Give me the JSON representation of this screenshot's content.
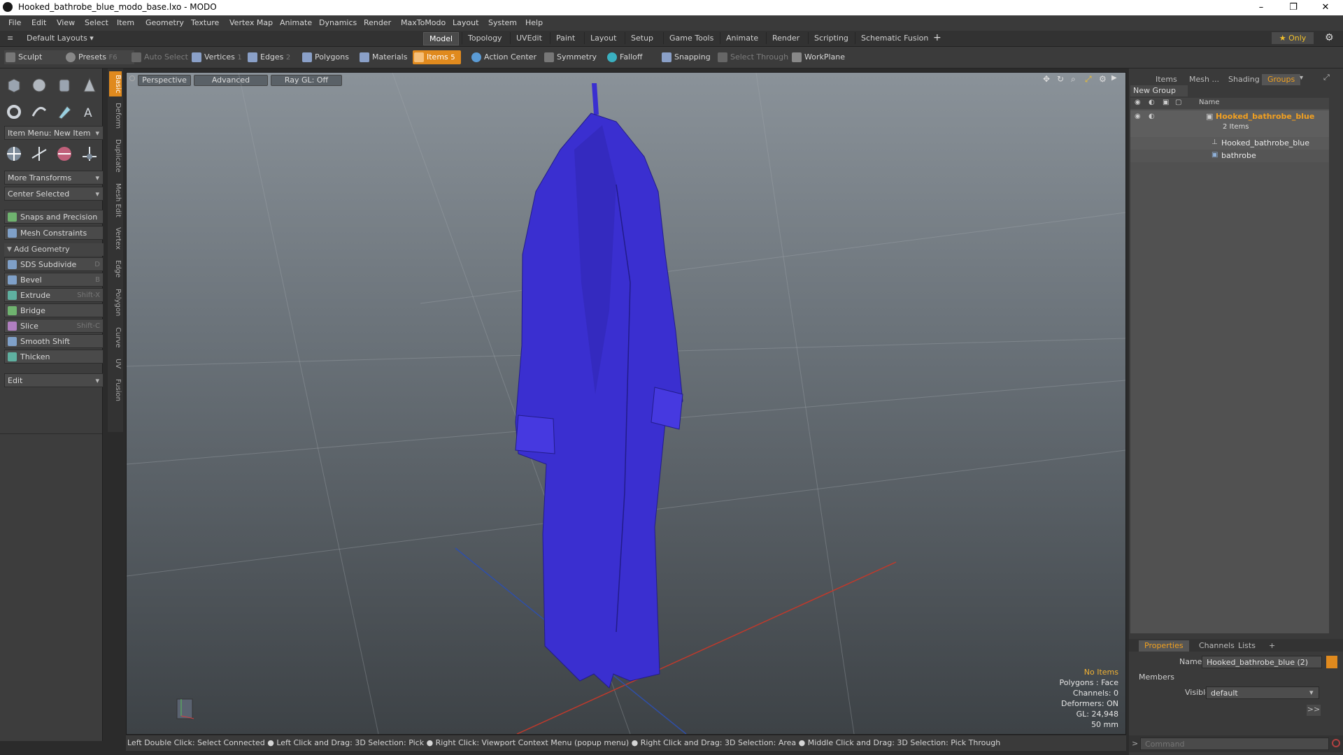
{
  "window": {
    "title": "Hooked_bathrobe_blue_modo_base.lxo - MODO",
    "minimize": "–",
    "restore": "❐",
    "close": "✕"
  },
  "menu": [
    "File",
    "Edit",
    "View",
    "Select",
    "Item",
    "Geometry",
    "Texture",
    "Vertex Map",
    "Animate",
    "Dynamics",
    "Render",
    "MaxToModo",
    "Layout",
    "System",
    "Help"
  ],
  "layout_bar": {
    "layouts_label": "Default Layouts ▾",
    "tabs": [
      "Model",
      "Topology",
      "UVEdit",
      "Paint",
      "Layout",
      "Setup",
      "Game Tools",
      "Animate",
      "Render",
      "Scripting",
      "Schematic Fusion"
    ],
    "active_tab": "Model",
    "plus": "+",
    "only_label": "★  Only"
  },
  "toolbar": {
    "sculpt": "Sculpt",
    "presets": "Presets",
    "presets_key": "F6",
    "auto_select": "Auto Select",
    "vertices": "Vertices",
    "vertices_num": "1",
    "edges": "Edges",
    "edges_num": "2",
    "polygons": "Polygons",
    "materials": "Materials",
    "items": "Items",
    "items_num": "5",
    "action_center": "Action Center",
    "symmetry": "Symmetry",
    "falloff": "Falloff",
    "snapping": "Snapping",
    "select_through": "Select Through",
    "workplane": "WorkPlane"
  },
  "left_panel": {
    "item_menu": "Item Menu: New Item",
    "more_transforms": "More Transforms",
    "center_selected": "Center Selected",
    "snaps": "Snaps and Precision",
    "mesh_constraints": "Mesh Constraints",
    "add_geometry": "Add Geometry",
    "tools": [
      {
        "label": "SDS Subdivide",
        "shortcut": "D"
      },
      {
        "label": "Bevel",
        "shortcut": "B"
      },
      {
        "label": "Extrude",
        "shortcut": "Shift-X"
      },
      {
        "label": "Bridge",
        "shortcut": ""
      },
      {
        "label": "Slice",
        "shortcut": "Shift-C"
      },
      {
        "label": "Smooth Shift",
        "shortcut": ""
      },
      {
        "label": "Thicken",
        "shortcut": ""
      }
    ],
    "edit": "Edit",
    "vtabs": [
      "Basic",
      "Deform",
      "Duplicate",
      "Mesh Edit",
      "Vertex",
      "Edge",
      "Polygon",
      "Curve",
      "UV",
      "Fusion"
    ]
  },
  "viewport": {
    "perspective": "Perspective",
    "advanced": "Advanced",
    "raygl": "Ray GL: Off",
    "info": {
      "no_items": "No Items",
      "polygons": "Polygons : Face",
      "channels": "Channels: 0",
      "deformers": "Deformers: ON",
      "gl": "GL: 24,948",
      "scale": "50 mm"
    }
  },
  "status_bar": "Left Double Click: Select Connected ● Left Click and Drag: 3D Selection: Pick ● Right Click: Viewport Context Menu (popup menu) ● Right Click and Drag: 3D Selection: Area ● Middle Click and Drag: 3D Selection: Pick Through",
  "right_panel": {
    "tabs": [
      "Items",
      "Mesh ...",
      "Shading",
      "Groups"
    ],
    "active_tab": "Groups",
    "new_group": "New Group",
    "name_header": "Name",
    "group_name": "Hooked_bathrobe_blue",
    "group_count": "2 Items",
    "children": [
      "Hooked_bathrobe_blue",
      "bathrobe"
    ],
    "bottom_tabs": [
      "Properties",
      "Channels",
      "Lists",
      "+"
    ],
    "name_label": "Name",
    "name_value": "Hooked_bathrobe_blue (2)",
    "members": "Members",
    "visible_label": "Visible",
    "visible_value": "default",
    "more": ">>",
    "command_placeholder": "Command"
  },
  "colors": {
    "accent": "#e08a1e",
    "robe": "#3a2fd0"
  }
}
